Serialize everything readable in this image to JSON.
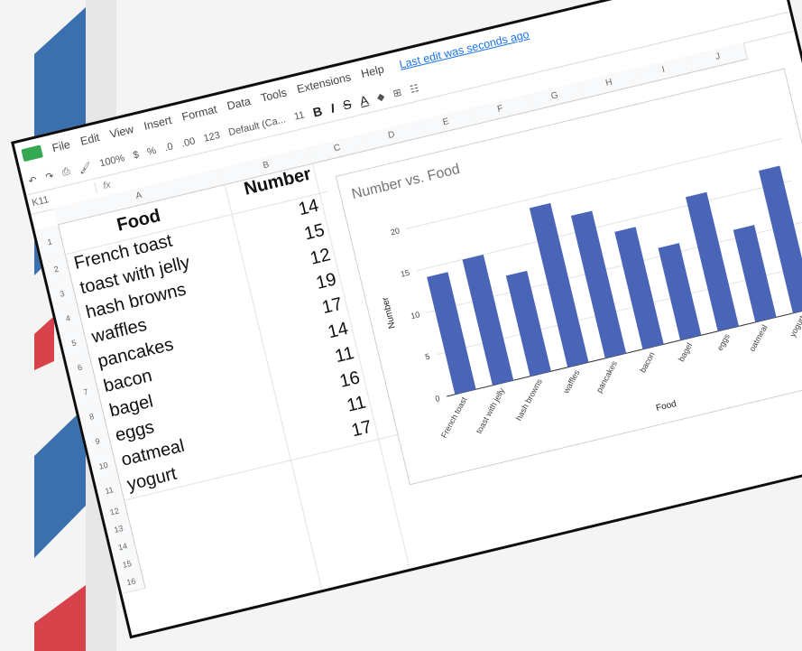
{
  "menu": {
    "items": [
      "File",
      "Edit",
      "View",
      "Insert",
      "Format",
      "Data",
      "Tools",
      "Extensions",
      "Help"
    ],
    "last_edit": "Last edit was seconds ago"
  },
  "toolbar": {
    "zoom": "100%",
    "currency": "$",
    "percent": "%",
    "dec_decrease": ".0",
    "dec_increase": ".00",
    "format_123": "123",
    "font": "Default (Ca...",
    "font_size": "11",
    "bold": "B",
    "italic": "I",
    "strike": "S",
    "text_color": "A"
  },
  "formula_bar": {
    "cell_ref": "K11",
    "fx": "fx"
  },
  "columns": [
    "A",
    "B",
    "C",
    "D",
    "E",
    "F",
    "G",
    "H",
    "I",
    "J"
  ],
  "rows": [
    "1",
    "2",
    "3",
    "4",
    "5",
    "6",
    "7",
    "8",
    "9",
    "10",
    "11",
    "12",
    "13",
    "14",
    "15",
    "16"
  ],
  "table": {
    "headers": {
      "food": "Food",
      "number": "Number"
    },
    "rows": [
      {
        "food": "French toast",
        "number": "14"
      },
      {
        "food": "toast with jelly",
        "number": "15"
      },
      {
        "food": "hash browns",
        "number": "12"
      },
      {
        "food": "waffles",
        "number": "19"
      },
      {
        "food": "pancakes",
        "number": "17"
      },
      {
        "food": "bacon",
        "number": "14"
      },
      {
        "food": "bagel",
        "number": "11"
      },
      {
        "food": "eggs",
        "number": "16"
      },
      {
        "food": "oatmeal",
        "number": "11"
      },
      {
        "food": "yogurt",
        "number": "17"
      }
    ]
  },
  "chart_data": {
    "type": "bar",
    "title": "Number vs. Food",
    "xlabel": "Food",
    "ylabel": "Number",
    "categories": [
      "French toast",
      "toast with jelly",
      "hash browns",
      "waffles",
      "pancakes",
      "bacon",
      "bagel",
      "eggs",
      "oatmeal",
      "yogurt"
    ],
    "values": [
      14,
      15,
      12,
      19,
      17,
      14,
      11,
      16,
      11,
      17
    ],
    "yticks": [
      0,
      5,
      10,
      15,
      20
    ],
    "ylim": [
      0,
      22
    ],
    "bar_color": "#4a65b8",
    "grid": true,
    "legend": "none"
  }
}
